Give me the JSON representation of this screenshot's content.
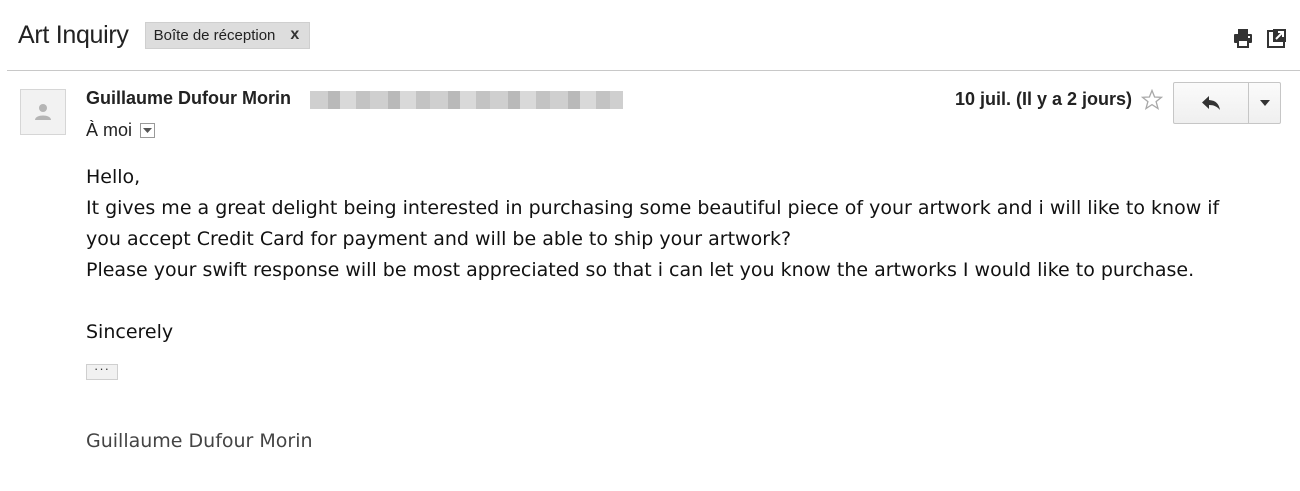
{
  "subject": {
    "title": "Art Inquiry",
    "label": "Boîte de réception",
    "label_remove": "x"
  },
  "toolbar": {
    "icons": [
      "print-icon",
      "new-window-icon"
    ]
  },
  "message": {
    "sender_name": "Guillaume Dufour Morin",
    "recipient": "À moi",
    "date": "10 juil. (Il y a 2 jours)",
    "body": {
      "greeting": "Hello,",
      "line1": "It gives me a great delight being interested in purchasing some beautiful piece of your artwork and i will like to know if",
      "line2": "you accept Credit Card for payment and will be able to ship your artwork?",
      "line3": "Please your swift response will be most appreciated so that i can let you know the artworks I would like to purchase.",
      "closing": "Sincerely",
      "show_trimmed": "···",
      "signature": "Guillaume Dufour Morin"
    }
  }
}
